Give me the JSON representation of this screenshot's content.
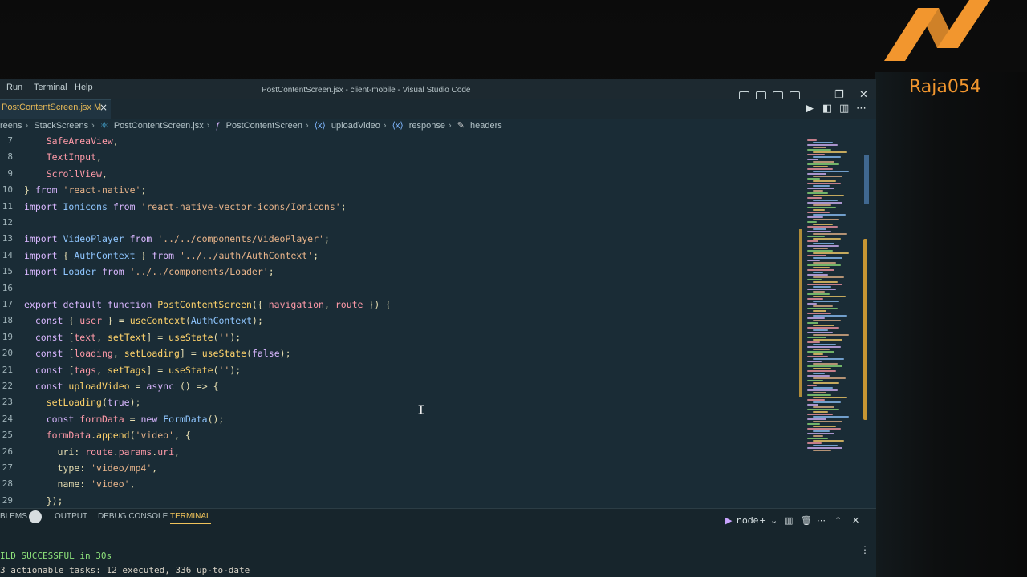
{
  "menu": {
    "items": [
      "Run",
      "Terminal",
      "Help"
    ]
  },
  "window_title": "PostContentScreen.jsx - client-mobile - Visual Studio Code",
  "tab": {
    "label": "PostContentScreen.jsx M",
    "close": "×"
  },
  "breadcrumb": [
    "reens",
    "StackScreens",
    "PostContentScreen.jsx",
    "PostContentScreen",
    "uploadVideo",
    "response",
    "headers"
  ],
  "code_lines": [
    {
      "n": "7",
      "text": "    SafeAreaView,"
    },
    {
      "n": "8",
      "text": "    TextInput,"
    },
    {
      "n": "9",
      "text": "    ScrollView,"
    },
    {
      "n": "10",
      "text": "} from 'react-native';"
    },
    {
      "n": "11",
      "text": "import Ionicons from 'react-native-vector-icons/Ionicons';"
    },
    {
      "n": "12",
      "text": ""
    },
    {
      "n": "13",
      "text": "import VideoPlayer from '../../components/VideoPlayer';"
    },
    {
      "n": "14",
      "text": "import { AuthContext } from '../../auth/AuthContext';"
    },
    {
      "n": "15",
      "text": "import Loader from '../../components/Loader';"
    },
    {
      "n": "16",
      "text": ""
    },
    {
      "n": "17",
      "text": "export default function PostContentScreen({ navigation, route }) {"
    },
    {
      "n": "18",
      "text": "  const { user } = useContext(AuthContext);"
    },
    {
      "n": "19",
      "text": "  const [text, setText] = useState('');"
    },
    {
      "n": "20",
      "text": "  const [loading, setLoading] = useState(false);"
    },
    {
      "n": "21",
      "text": "  const [tags, setTags] = useState('');"
    },
    {
      "n": "22",
      "text": "  const uploadVideo = async () => {"
    },
    {
      "n": "23",
      "text": "    setLoading(true);"
    },
    {
      "n": "24",
      "text": "    const formData = new FormData();"
    },
    {
      "n": "25",
      "text": "    formData.append('video', {"
    },
    {
      "n": "26",
      "text": "      uri: route.params.uri,"
    },
    {
      "n": "27",
      "text": "      type: 'video/mp4',"
    },
    {
      "n": "28",
      "text": "      name: 'video',"
    },
    {
      "n": "29",
      "text": "    });"
    }
  ],
  "panel": {
    "tabs": [
      "BLEMS",
      "OUTPUT",
      "DEBUG CONSOLE",
      "TERMINAL"
    ],
    "shell": "node",
    "terminal_lines": [
      "ILD SUCCESSFUL in 30s",
      "3 actionable tasks: 12 executed, 336 up-to-date"
    ]
  },
  "watermark": "Raja054",
  "colors": {
    "accent": "#f2962e",
    "editor_bg": "#1a2c36",
    "terminal_active": "#f0c35a"
  }
}
